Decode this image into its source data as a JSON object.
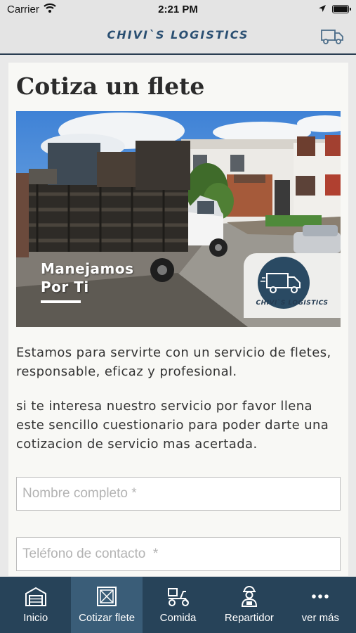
{
  "status_bar": {
    "carrier": "Carrier",
    "time": "2:21 PM"
  },
  "nav_bar": {
    "brand": "CHIVI`S LOGISTICS",
    "right_icon": "truck-icon"
  },
  "page": {
    "title": "Cotiza un flete",
    "hero": {
      "slogan": "Manejamos\nPor Ti",
      "logo_text": "CHIVI`S LOGISTICS"
    },
    "paragraphs": [
      "Estamos para servirte con un servicio de fletes, responsable, eficaz y profesional.",
      "si te interesa nuestro servicio por favor llena este sencillo cuestionario para poder darte una cotizacion de servicio mas acertada."
    ],
    "form": {
      "name_placeholder": "Nombre completo *",
      "phone_placeholder": "Teléfono de contacto  *"
    }
  },
  "tab_bar": {
    "tabs": [
      {
        "label": "Inicio",
        "icon": "warehouse-icon",
        "active": false
      },
      {
        "label": "Cotizar flete",
        "icon": "crate-icon",
        "active": true
      },
      {
        "label": "Comida",
        "icon": "scooter-icon",
        "active": false
      },
      {
        "label": "Repartidor",
        "icon": "delivery-person-icon",
        "active": false
      },
      {
        "label": "ver más",
        "icon": "more-dots-icon",
        "active": false
      }
    ]
  },
  "colors": {
    "nav_text": "#2a4f72",
    "tab_bar": "#274359",
    "tab_active": "#3a5d78",
    "card_bg": "#f8f8f5"
  }
}
